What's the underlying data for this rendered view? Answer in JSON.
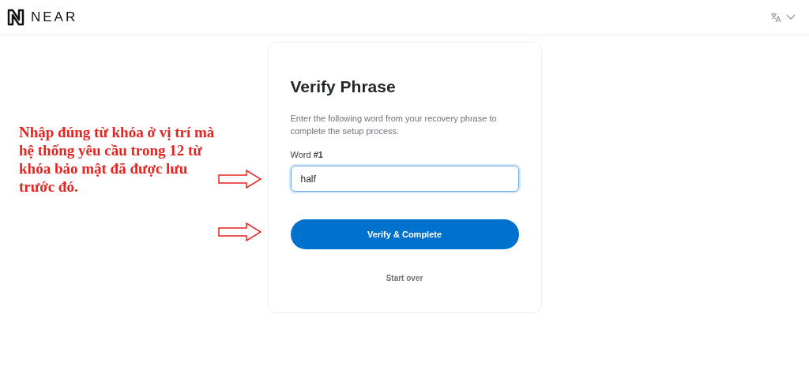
{
  "header": {
    "logo": "NEAR"
  },
  "card": {
    "title": "Verify Phrase",
    "description": "Enter the following word from your recovery phrase to complete the setup process.",
    "field_label": "Word **#1**",
    "field_value": "half",
    "field_focused": true,
    "primary_button": "Verify & Complete",
    "secondary_button": "Start over"
  },
  "annotation": {
    "text": "Nhập đúng từ khóa ở vị trí mà hệ thống yêu cầu trong 12 từ khóa bảo mật đã được lưu trước đó."
  }
}
